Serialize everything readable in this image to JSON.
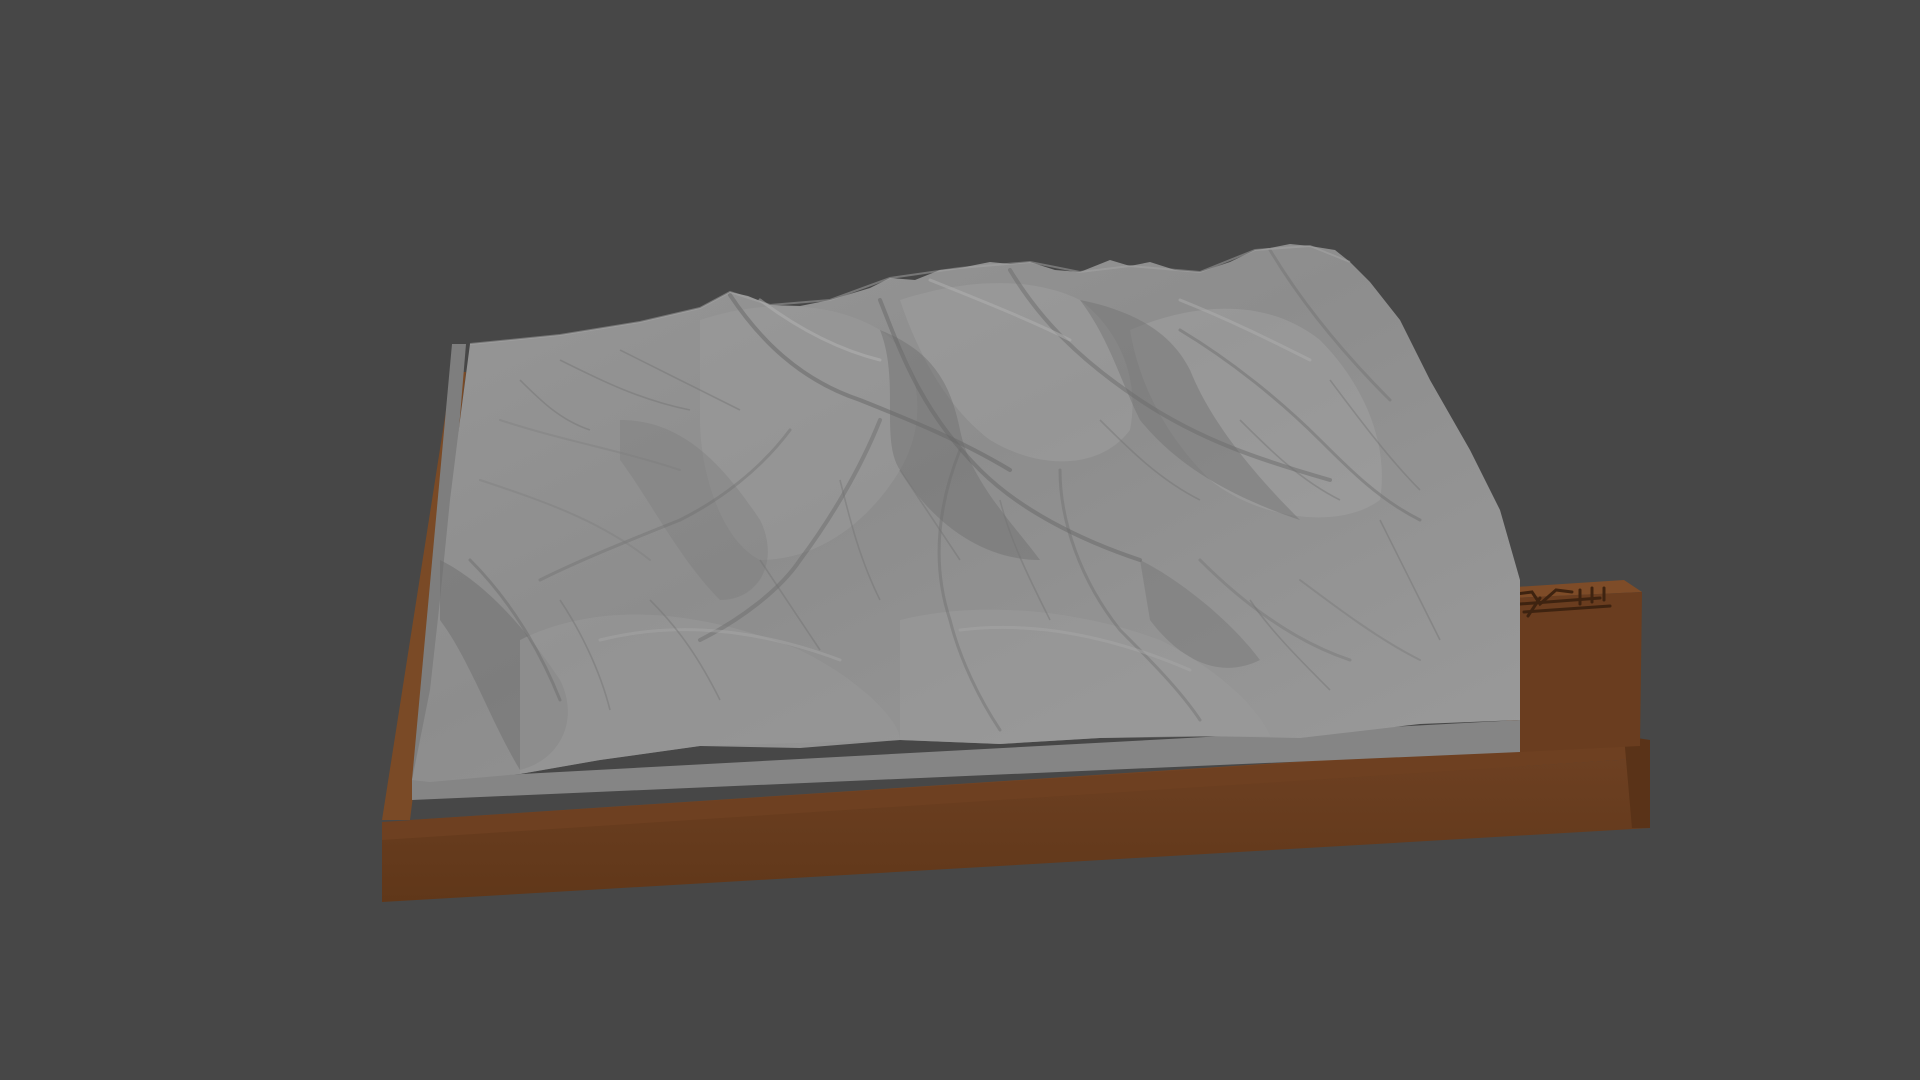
{
  "viewport": {
    "background_color": "#474747",
    "object": "terrain-relief-model"
  },
  "model": {
    "terrain_color": "#8e8e8e",
    "terrain_side_color": "#858585",
    "base_color": "#6a3f20",
    "tag_icon": "engraved-label-icon"
  }
}
